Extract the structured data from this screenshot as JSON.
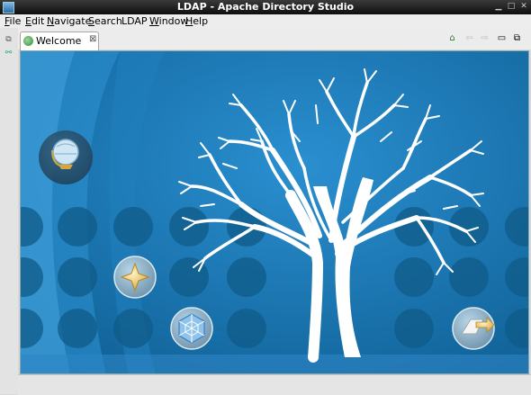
{
  "window": {
    "title": "LDAP - Apache Directory Studio"
  },
  "menu": {
    "items": [
      {
        "label": "File",
        "mnemonic": "F",
        "rest": "ile"
      },
      {
        "label": "Edit",
        "mnemonic": "E",
        "rest": "dit"
      },
      {
        "label": "Navigate",
        "mnemonic": "N",
        "rest": "avigate"
      },
      {
        "label": "Search",
        "mnemonic": "S",
        "rest": "earch"
      },
      {
        "label": "LDAP",
        "mnemonic": "",
        "rest": "LDAP"
      },
      {
        "label": "Window",
        "mnemonic": "W",
        "rest": "indow"
      },
      {
        "label": "Help",
        "mnemonic": "H",
        "rest": "elp"
      }
    ]
  },
  "editor": {
    "tabs": [
      {
        "label": "Welcome",
        "close": "⊠",
        "icon": "welcome-icon"
      }
    ]
  },
  "welcome": {
    "icons": [
      "overview-globe-icon",
      "tutorials-star-icon",
      "samples-web-icon",
      "workbench-arrow-icon"
    ],
    "colors": {
      "background": "#1470a8",
      "tree": "#ffffff",
      "dots": "#12608f"
    }
  }
}
